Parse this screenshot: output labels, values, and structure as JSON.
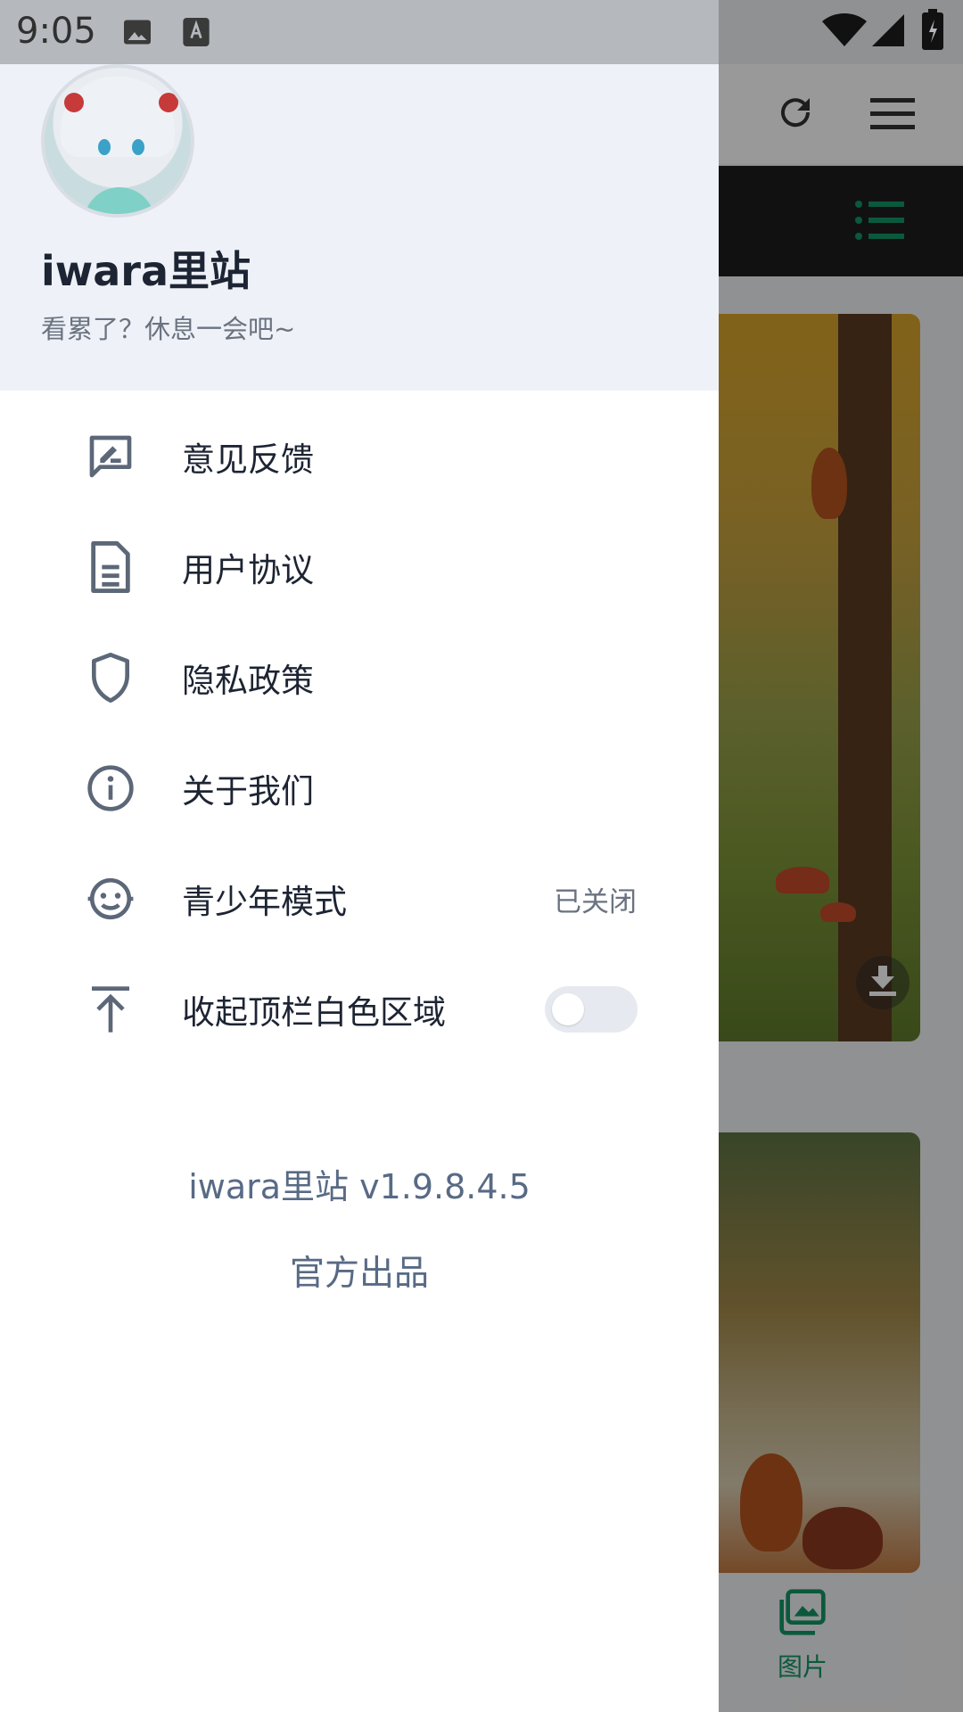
{
  "status_bar": {
    "time": "9:05"
  },
  "drawer": {
    "title": "iwara里站",
    "subtitle": "看累了？休息一会吧~",
    "menu": [
      {
        "label": "意见反馈",
        "icon": "feedback-icon"
      },
      {
        "label": "用户协议",
        "icon": "document-icon"
      },
      {
        "label": "隐私政策",
        "icon": "shield-icon"
      },
      {
        "label": "关于我们",
        "icon": "info-icon"
      },
      {
        "label": "青少年模式",
        "icon": "child-face-icon",
        "value": "已关闭"
      },
      {
        "label": "收起顶栏白色区域",
        "icon": "collapse-top-icon",
        "toggle": false
      }
    ],
    "version": "iwara里站 v1.9.8.4.5",
    "official": "官方出品"
  },
  "background": {
    "bottom_tab_label": "图片",
    "accent": "#139565"
  }
}
